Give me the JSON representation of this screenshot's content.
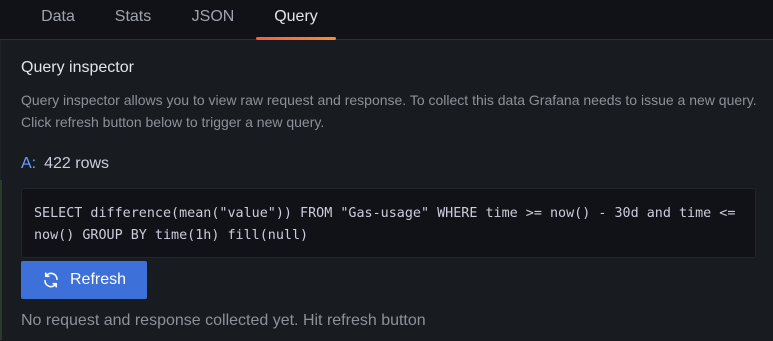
{
  "tabs": [
    {
      "label": "Data",
      "active": false
    },
    {
      "label": "Stats",
      "active": false
    },
    {
      "label": "JSON",
      "active": false
    },
    {
      "label": "Query",
      "active": true
    }
  ],
  "inspector": {
    "title": "Query inspector",
    "description": "Query inspector allows you to view raw request and response. To collect this data Grafana needs to issue a new query. Click refresh button below to trigger a new query.",
    "query_ref": "A:",
    "query_rows": "422 rows",
    "query_text": "SELECT difference(mean(\"value\")) FROM \"Gas-usage\" WHERE time >= now() - 30d and time <= now() GROUP BY time(1h) fill(null)",
    "refresh_label": "Refresh",
    "refresh_icon": "sync-icon",
    "status": "No request and response collected yet. Hit refresh button"
  },
  "colors": {
    "accent_tab": "#f55f3e",
    "primary_button": "#3d71d9",
    "query_ref": "#6e9fff"
  }
}
